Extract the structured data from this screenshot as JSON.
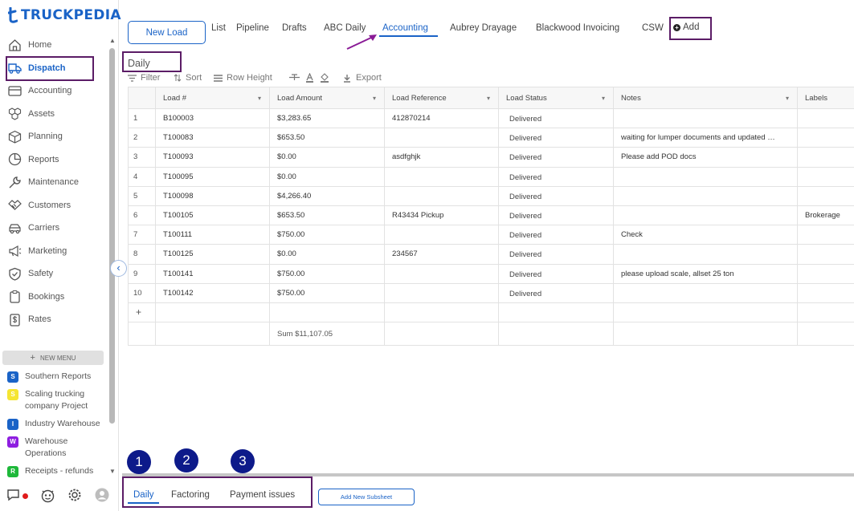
{
  "app": {
    "logo_text": "TRUCKPEDIA",
    "brand_color": "#1a63c7",
    "highlight_color": "#5b1c66"
  },
  "sidebar": {
    "items": [
      {
        "label": "Home",
        "icon": "home-icon"
      },
      {
        "label": "Dispatch",
        "icon": "truck-icon"
      },
      {
        "label": "Accounting",
        "icon": "card-icon"
      },
      {
        "label": "Assets",
        "icon": "cubes-icon"
      },
      {
        "label": "Planning",
        "icon": "box-icon"
      },
      {
        "label": "Reports",
        "icon": "pie-chart-icon"
      },
      {
        "label": "Maintenance",
        "icon": "wrench-icon"
      },
      {
        "label": "Customers",
        "icon": "handshake-icon"
      },
      {
        "label": "Carriers",
        "icon": "car-icon"
      },
      {
        "label": "Marketing",
        "icon": "megaphone-icon"
      },
      {
        "label": "Safety",
        "icon": "shield-check-icon"
      },
      {
        "label": "Bookings",
        "icon": "clipboard-icon"
      },
      {
        "label": "Rates",
        "icon": "dollar-doc-icon"
      }
    ],
    "new_menu_label": "NEW MENU",
    "projects": [
      {
        "badge": "S",
        "color": "#1a63c7",
        "label": "Southern Reports"
      },
      {
        "badge": "S",
        "color": "#f5e532",
        "label": "Scaling trucking company Project"
      },
      {
        "badge": "I",
        "color": "#1a63c7",
        "label": "Industry Warehouse"
      },
      {
        "badge": "W",
        "color": "#8e1ee0",
        "label": "Warehouse Operations"
      },
      {
        "badge": "R",
        "color": "#1eb83a",
        "label": "Receipts - refunds"
      }
    ]
  },
  "topbar": {
    "new_load_label": "New Load",
    "tabs": [
      "List",
      "Pipeline",
      "Drafts",
      "ABC Daily",
      "Accounting",
      "Aubrey Drayage",
      "Blackwood Invoicing",
      "CSW"
    ],
    "add_label": "Add"
  },
  "sheet": {
    "title": "Daily",
    "toolbar": {
      "filter": "Filter",
      "sort": "Sort",
      "row_height": "Row Height",
      "export": "Export"
    },
    "columns": [
      "Load #",
      "Load Amount",
      "Load Reference",
      "Load Status",
      "Notes",
      "Labels"
    ],
    "rows": [
      {
        "n": "1",
        "load": "B100003",
        "amount": "$3,283.65",
        "ref": "412870214",
        "status": "Delivered",
        "notes": "",
        "labels": ""
      },
      {
        "n": "2",
        "load": "T100083",
        "amount": "$653.50",
        "ref": "",
        "status": "Delivered",
        "notes": "waiting for lumper documents and updated …",
        "labels": ""
      },
      {
        "n": "3",
        "load": "T100093",
        "amount": "$0.00",
        "ref": "asdfghjk",
        "status": "Delivered",
        "notes": "Please add POD docs",
        "labels": ""
      },
      {
        "n": "4",
        "load": "T100095",
        "amount": "$0.00",
        "ref": "",
        "status": "Delivered",
        "notes": "",
        "labels": ""
      },
      {
        "n": "5",
        "load": "T100098",
        "amount": "$4,266.40",
        "ref": "",
        "status": "Delivered",
        "notes": "",
        "labels": ""
      },
      {
        "n": "6",
        "load": "T100105",
        "amount": "$653.50",
        "ref": "R43434 Pickup",
        "status": "Delivered",
        "notes": "",
        "labels": "Brokerage"
      },
      {
        "n": "7",
        "load": "T100111",
        "amount": "$750.00",
        "ref": "",
        "status": "Delivered",
        "notes": "Check",
        "labels": ""
      },
      {
        "n": "8",
        "load": "T100125",
        "amount": "$0.00",
        "ref": "234567",
        "status": "Delivered",
        "notes": "",
        "labels": ""
      },
      {
        "n": "9",
        "load": "T100141",
        "amount": "$750.00",
        "ref": "",
        "status": "Delivered",
        "notes": "please upload scale, allset 25 ton",
        "labels": ""
      },
      {
        "n": "10",
        "load": "T100142",
        "amount": "$750.00",
        "ref": "",
        "status": "Delivered",
        "notes": "",
        "labels": ""
      }
    ],
    "add_row": "+",
    "sum_label": "Sum $11,107.05"
  },
  "subsheets": {
    "tabs": [
      "Daily",
      "Factoring",
      "Payment issues"
    ],
    "add_label": "Add New Subsheet",
    "callouts": [
      "1",
      "2",
      "3"
    ]
  }
}
